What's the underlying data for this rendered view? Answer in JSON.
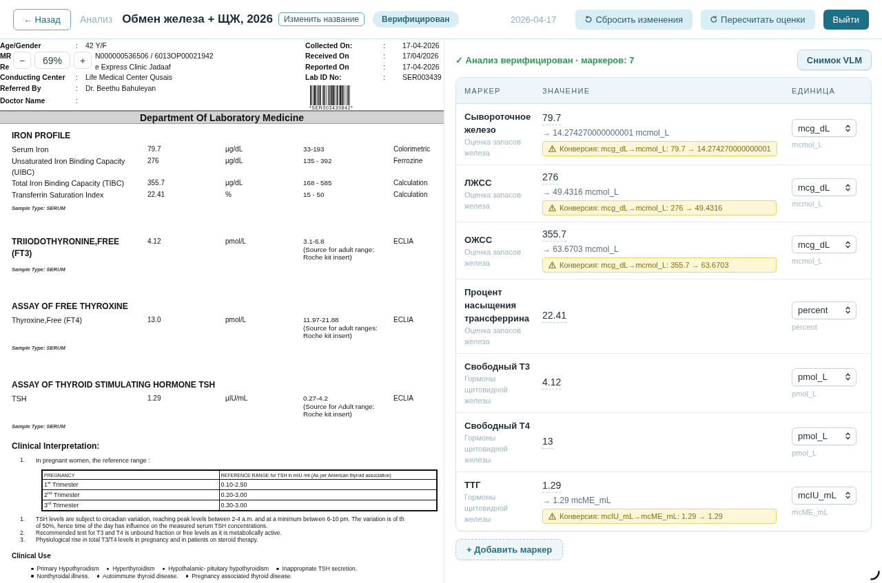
{
  "header": {
    "back_button": "← Назад",
    "breadcrumb": "Анализ",
    "title": "Обмен железа + ЩЖ, 2026",
    "rename_button": "Изменить название",
    "status_badge": "Верифицирован",
    "date": "2026-04-17",
    "actions": [
      {
        "kind": "reset",
        "label": "Сбросить изменения"
      },
      {
        "kind": "recalculate",
        "label": "Пересчитать оценки"
      },
      {
        "kind": "exit",
        "label": "Выйти"
      }
    ]
  },
  "document": {
    "zoom_control": {
      "decrease": "−",
      "value": "69%",
      "increase": "+"
    },
    "patient_fields": [
      {
        "label": "Age/Gender",
        "colon": ":",
        "value": "42 Y/F"
      },
      {
        "label": "MR",
        "value": "N000000536506 / 6013OP00021942"
      },
      {
        "label": "Re",
        "value": "e Express Clinic Jadaaf"
      },
      {
        "label": "Conducting Center",
        "colon": ":",
        "value": "Life Medical Center Qusais"
      },
      {
        "label": "Referred By",
        "colon": ":",
        "value": "Dr. Beethu Bahuleyan"
      },
      {
        "label": "Doctor Name",
        "colon": ":"
      }
    ],
    "report_fields": [
      {
        "label": "Collected On:",
        "colon": ":",
        "value": "17-04-2026"
      },
      {
        "label": "Received On",
        "colon": ":",
        "value": "17/04/2026"
      },
      {
        "label": "Reported On",
        "colon": ":",
        "value": "17-04-2026"
      },
      {
        "label": "Lab ID No:",
        "colon": ":",
        "value": "SER003439"
      }
    ],
    "barcode_caption": "*SER003439842*",
    "department": "Department Of Laboratory Medicine",
    "sections": [
      {
        "title": "IRON PROFILE",
        "rows": [
          {
            "kind": "plain",
            "test": "Serum Iron",
            "result": "79.7",
            "unit": "µg/dL",
            "range": [
              "33-193"
            ],
            "method": "Colorimetric"
          },
          {
            "kind": "plain",
            "test": "Unsaturated Iron Binding Capacity (UIBC)",
            "result": "276",
            "unit": "µg/dL",
            "range": [
              "135 - 392"
            ],
            "method": "Ferrozine"
          },
          {
            "kind": "plain",
            "test": "Total Iron Binding Capacity (TIBC)",
            "result": "355.7",
            "unit": "µg/dL",
            "range": [
              "168 - 585"
            ],
            "method": "Calculation"
          },
          {
            "kind": "plain",
            "test": "Transferrin Saturation Index",
            "result": "22.41",
            "unit": "%",
            "range": [
              "15 - 50"
            ],
            "method": "Calculation"
          }
        ],
        "sample_type": "Sample Type: SERUM"
      },
      {
        "rows": [
          {
            "kind": "heading",
            "test": "TRIIODOTHYRONINE,FREE (FT3)",
            "result": "4.12",
            "unit": "pmol/L",
            "range": [
              "3.1-6.8",
              "(Source for adult range:",
              "Roche kit insert)"
            ],
            "method": "ECLIA"
          }
        ],
        "sample_type": "Sample Type: SERUM"
      },
      {
        "title": "ASSAY OF FREE THYROXINE",
        "rows": [
          {
            "kind": "plain",
            "test": "Thyroxine,Free (FT4)",
            "result": "13.0",
            "unit": "pmol/L",
            "range": [
              "11.97-21.88",
              "(Source for adult ranges:",
              "Roche kit insert)"
            ],
            "method": "ECLIA"
          }
        ],
        "sample_type": "Sample Type: SERUM"
      },
      {
        "title": "ASSAY OF THYROID STIMULATING HORMONE TSH",
        "rows": [
          {
            "kind": "plain",
            "test": "TSH",
            "result": "1.29",
            "unit": "µIU/mL",
            "range": [
              "0.27-4.2",
              "(Source for Adult range:",
              "Roche kit insert)"
            ],
            "method": "ECLIA"
          }
        ],
        "sample_type": "Sample Type: SERUM"
      }
    ],
    "clinical_interpretation": {
      "title": "Clinical Interpretation:",
      "intro": {
        "number": "1.",
        "text": "In pregnant women, the reference range :"
      },
      "table": {
        "columns": [
          "PREGNANCY",
          "REFERENCE RANGE for TSH in mIU /ml (As per American thyroid association)"
        ],
        "rows": [
          [
            "1$^{st}$ Trimester",
            "0.10-2.50"
          ],
          [
            "2$^{nd}$ Trimester",
            "0.20-3.00"
          ],
          [
            "3$^{rd}$ Trimester",
            "0.30-3.00"
          ]
        ]
      },
      "notes": [
        {
          "number": "1.",
          "lines": [
            "TSH levels are subject to circadian variation, reaching peak levels between 2-4 a.m. and at a minimum between 6-10 pm. The variation is of th",
            "of 50%, hence time of the day has influence on the measured serum TSH concentrations."
          ]
        },
        {
          "number": "2.",
          "lines": [
            "Recommended test for T3 and T4 is unbound fraction or free levels as it is metabolically active."
          ]
        },
        {
          "number": "3.",
          "lines": [
            "Physiological rise in total T3/T4 levels in pregnancy and in patients on steroid therapy."
          ]
        }
      ]
    },
    "clinical_use": {
      "title": "Clinical Use",
      "lines": [
        [
          "Primary Hypothyroidism",
          "Hyperthyroidism",
          "Hypothalamic- pituitary hypothyroidism",
          "Inappropriate TSH secretion."
        ],
        [
          "Nonthyroidal illness.",
          "Autoimmune thyroid disease.",
          "Pregnancy associated thyroid disease."
        ]
      ]
    }
  },
  "markers": {
    "status": "✓ Анализ верифицирован · маркеров: 7",
    "snapshot_button": "Снимок VLM",
    "columns": [
      "МАРКЕР",
      "ЗНАЧЕНИЕ",
      "ЕДИНИЦА"
    ],
    "rows": [
      {
        "name": "Сывороточное железо",
        "group": "Оценка запасов железа",
        "value": "79.7",
        "converted": "→ 14.274270000000001 mcmol_L",
        "warning": "Конверсия: mcg_dL→mcmol_L: 79.7 → 14.274270000000001",
        "unit": "mcg_dL",
        "unit_hint": "mcmol_L"
      },
      {
        "name": "ЛЖСС",
        "group": "Оценка запасов железа",
        "value": "276",
        "converted": "→ 49.4316 mcmol_L",
        "warning": "Конверсия: mcg_dL→mcmol_L: 276 → 49.4316",
        "unit": "mcg_dL",
        "unit_hint": "mcmol_L"
      },
      {
        "name": "ОЖСС",
        "group": "Оценка запасов железа",
        "value": "355.7",
        "converted": "→ 63.6703 mcmol_L",
        "warning": "Конверсия: mcg_dL→mcmol_L: 355.7 → 63.6703",
        "unit": "mcg_dL",
        "unit_hint": "mcmol_L"
      },
      {
        "name": "Процент насыщения трансферрина",
        "group": "Оценка запасов железа",
        "value": "22.41",
        "unit": "percent",
        "unit_hint": "percent"
      },
      {
        "name": "Свободный Т3",
        "group": "Гормоны щитовидной железы",
        "value": "4.12",
        "unit": "pmol_L",
        "unit_hint": "pmol_L"
      },
      {
        "name": "Свободный Т4",
        "group": "Гормоны щитовидной железы",
        "value": "13",
        "unit": "pmol_L",
        "unit_hint": "pmol_L"
      },
      {
        "name": "ТТГ",
        "group": "Гормоны щитовидной железы",
        "value": "1.29",
        "converted": "→ 1.29 mcME_mL",
        "warning": "Конверсия: mcIU_mL→mcME_mL: 1.29 → 1.29",
        "unit": "mcIU_mL",
        "unit_hint": "mcME_mL"
      }
    ],
    "add_button": "+ Добавить маркер"
  }
}
